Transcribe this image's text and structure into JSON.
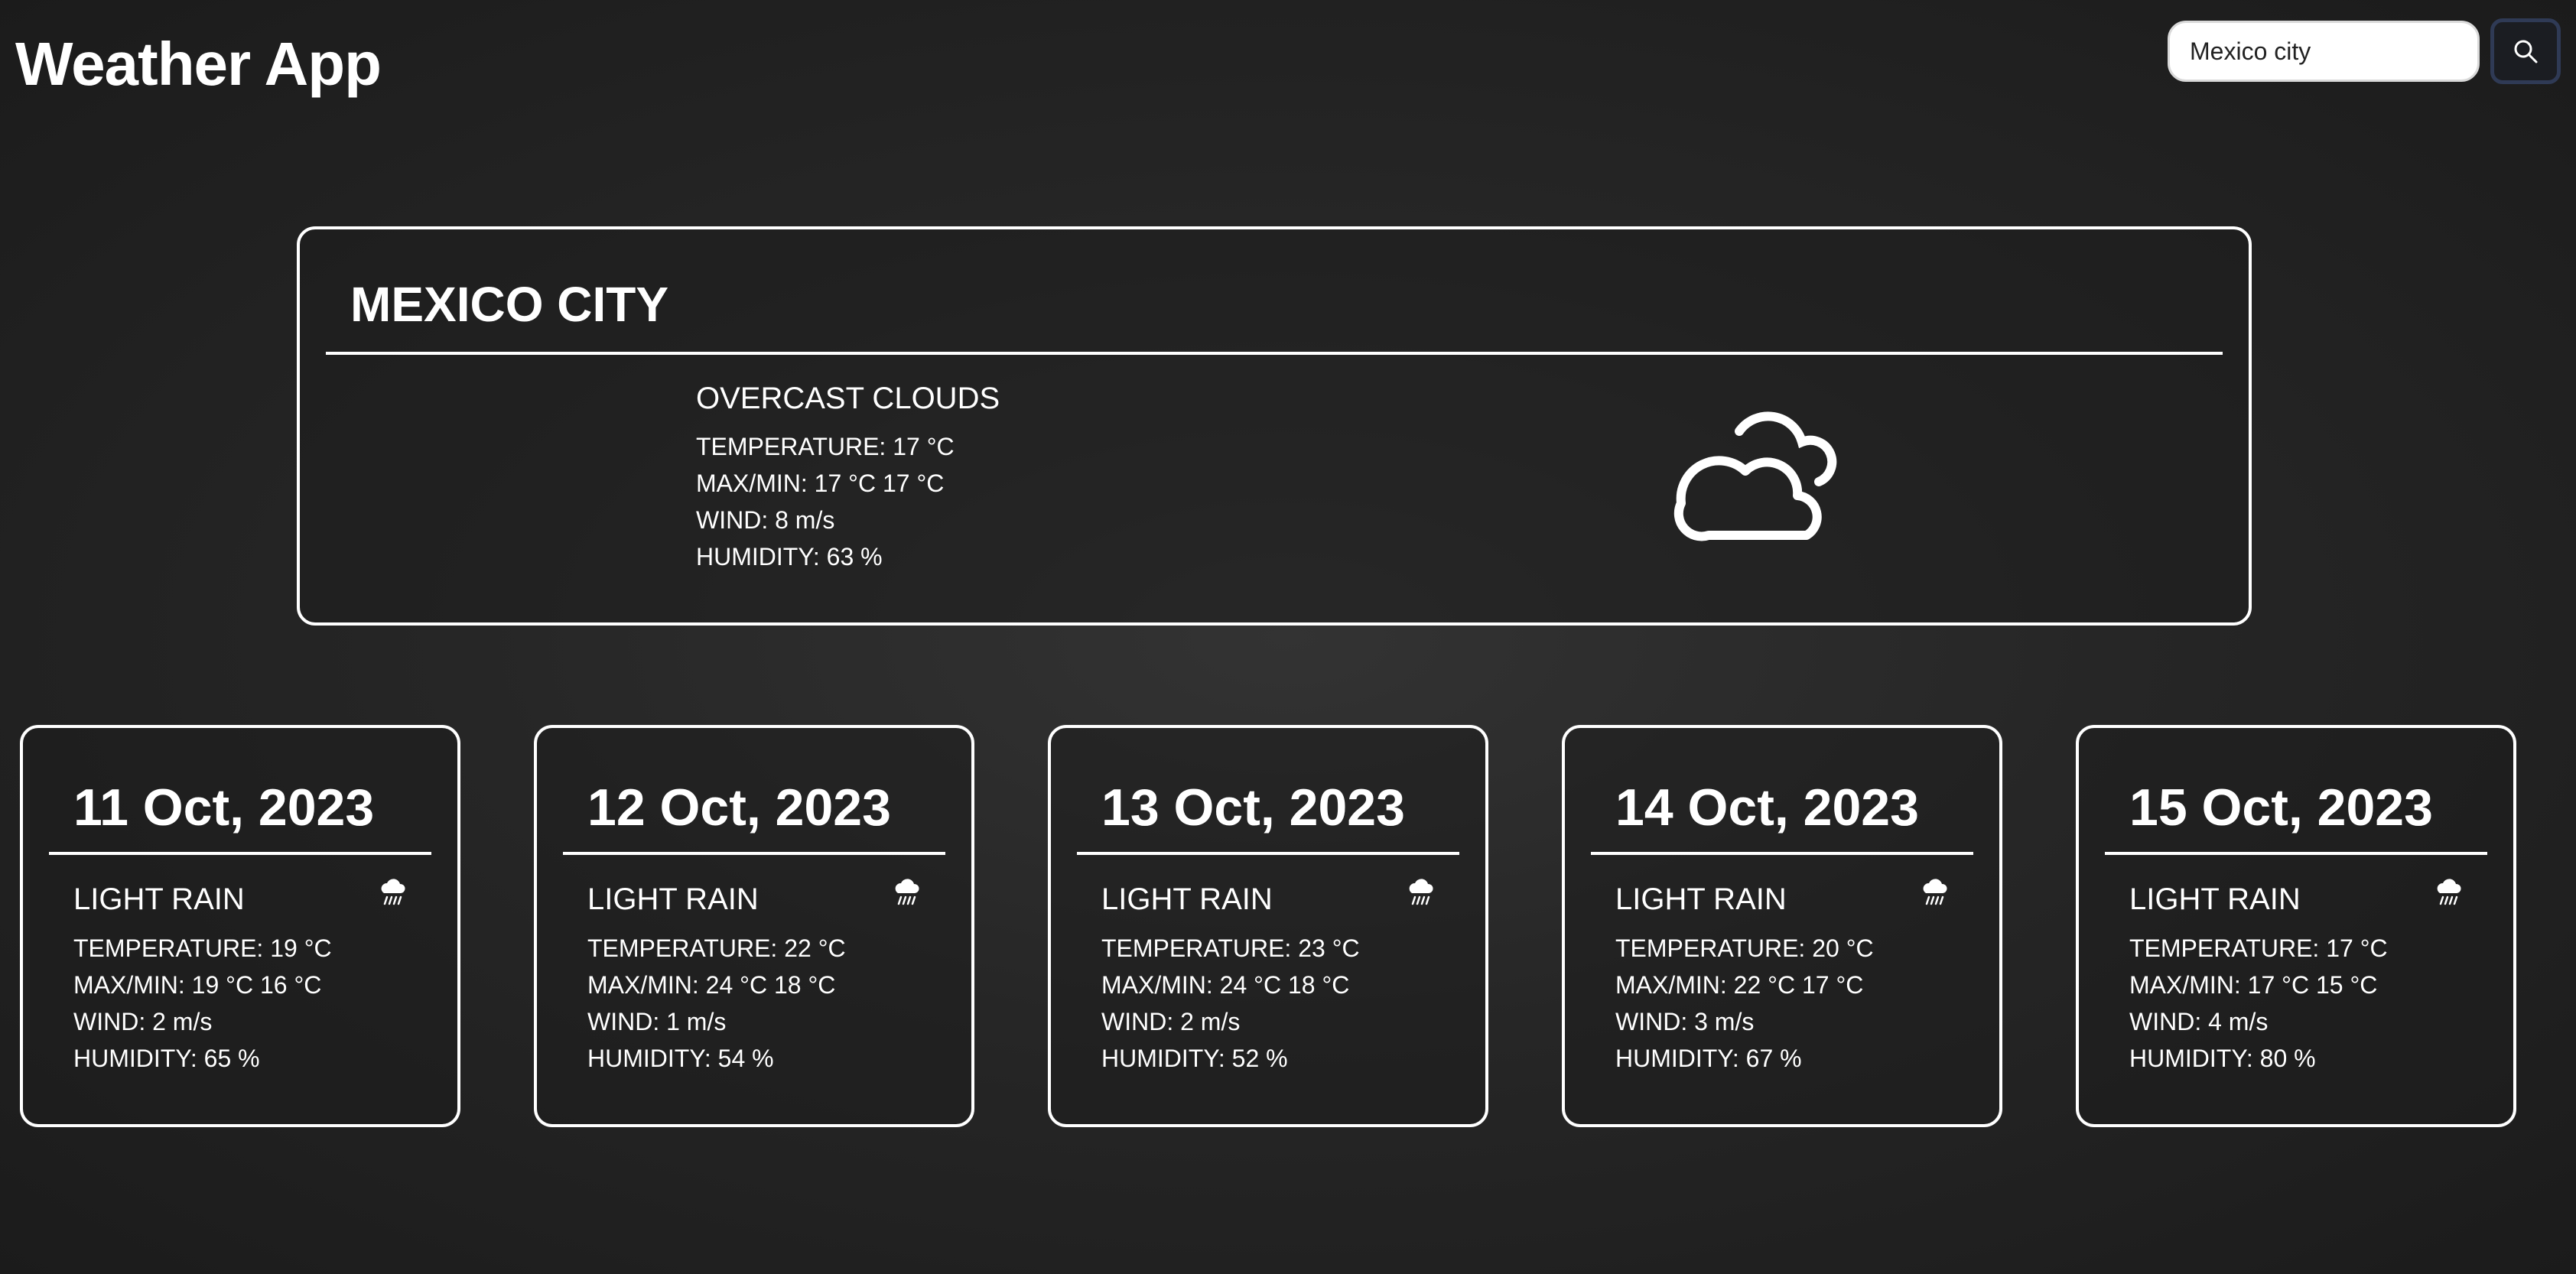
{
  "app": {
    "title": "Weather App"
  },
  "search": {
    "value": "Mexico city",
    "icon": "search-icon"
  },
  "current": {
    "city": "MEXICO CITY",
    "condition": "OVERCAST CLOUDS",
    "temperature": "TEMPERATURE: 17 °C",
    "maxmin": "MAX/MIN: 17 °C 17 °C",
    "wind": "WIND: 8 m/s",
    "humidity": "HUMIDITY: 63 %",
    "icon": "overcast-clouds-icon"
  },
  "forecast": [
    {
      "date": "11 Oct, 2023",
      "condition": "LIGHT RAIN",
      "temperature": "TEMPERATURE: 19 °C",
      "maxmin": "MAX/MIN: 19 °C 16 °C",
      "wind": "WIND: 2 m/s",
      "humidity": "HUMIDITY: 65 %",
      "icon": "light-rain-icon"
    },
    {
      "date": "12 Oct, 2023",
      "condition": "LIGHT RAIN",
      "temperature": "TEMPERATURE: 22 °C",
      "maxmin": "MAX/MIN: 24 °C 18 °C",
      "wind": "WIND: 1 m/s",
      "humidity": "HUMIDITY: 54 %",
      "icon": "light-rain-icon"
    },
    {
      "date": "13 Oct, 2023",
      "condition": "LIGHT RAIN",
      "temperature": "TEMPERATURE: 23 °C",
      "maxmin": "MAX/MIN: 24 °C 18 °C",
      "wind": "WIND: 2 m/s",
      "humidity": "HUMIDITY: 52 %",
      "icon": "light-rain-icon"
    },
    {
      "date": "14 Oct, 2023",
      "condition": "LIGHT RAIN",
      "temperature": "TEMPERATURE: 20 °C",
      "maxmin": "MAX/MIN: 22 °C 17 °C",
      "wind": "WIND: 3 m/s",
      "humidity": "HUMIDITY: 67 %",
      "icon": "light-rain-icon"
    },
    {
      "date": "15 Oct, 2023",
      "condition": "LIGHT RAIN",
      "temperature": "TEMPERATURE: 17 °C",
      "maxmin": "MAX/MIN: 17 °C 15 °C",
      "wind": "WIND: 4 m/s",
      "humidity": "HUMIDITY: 80 %",
      "icon": "light-rain-icon"
    }
  ],
  "colors": {
    "background": "#262626",
    "text": "#ffffff",
    "card_border": "#ffffff",
    "search_button_border": "#2f3a55"
  }
}
